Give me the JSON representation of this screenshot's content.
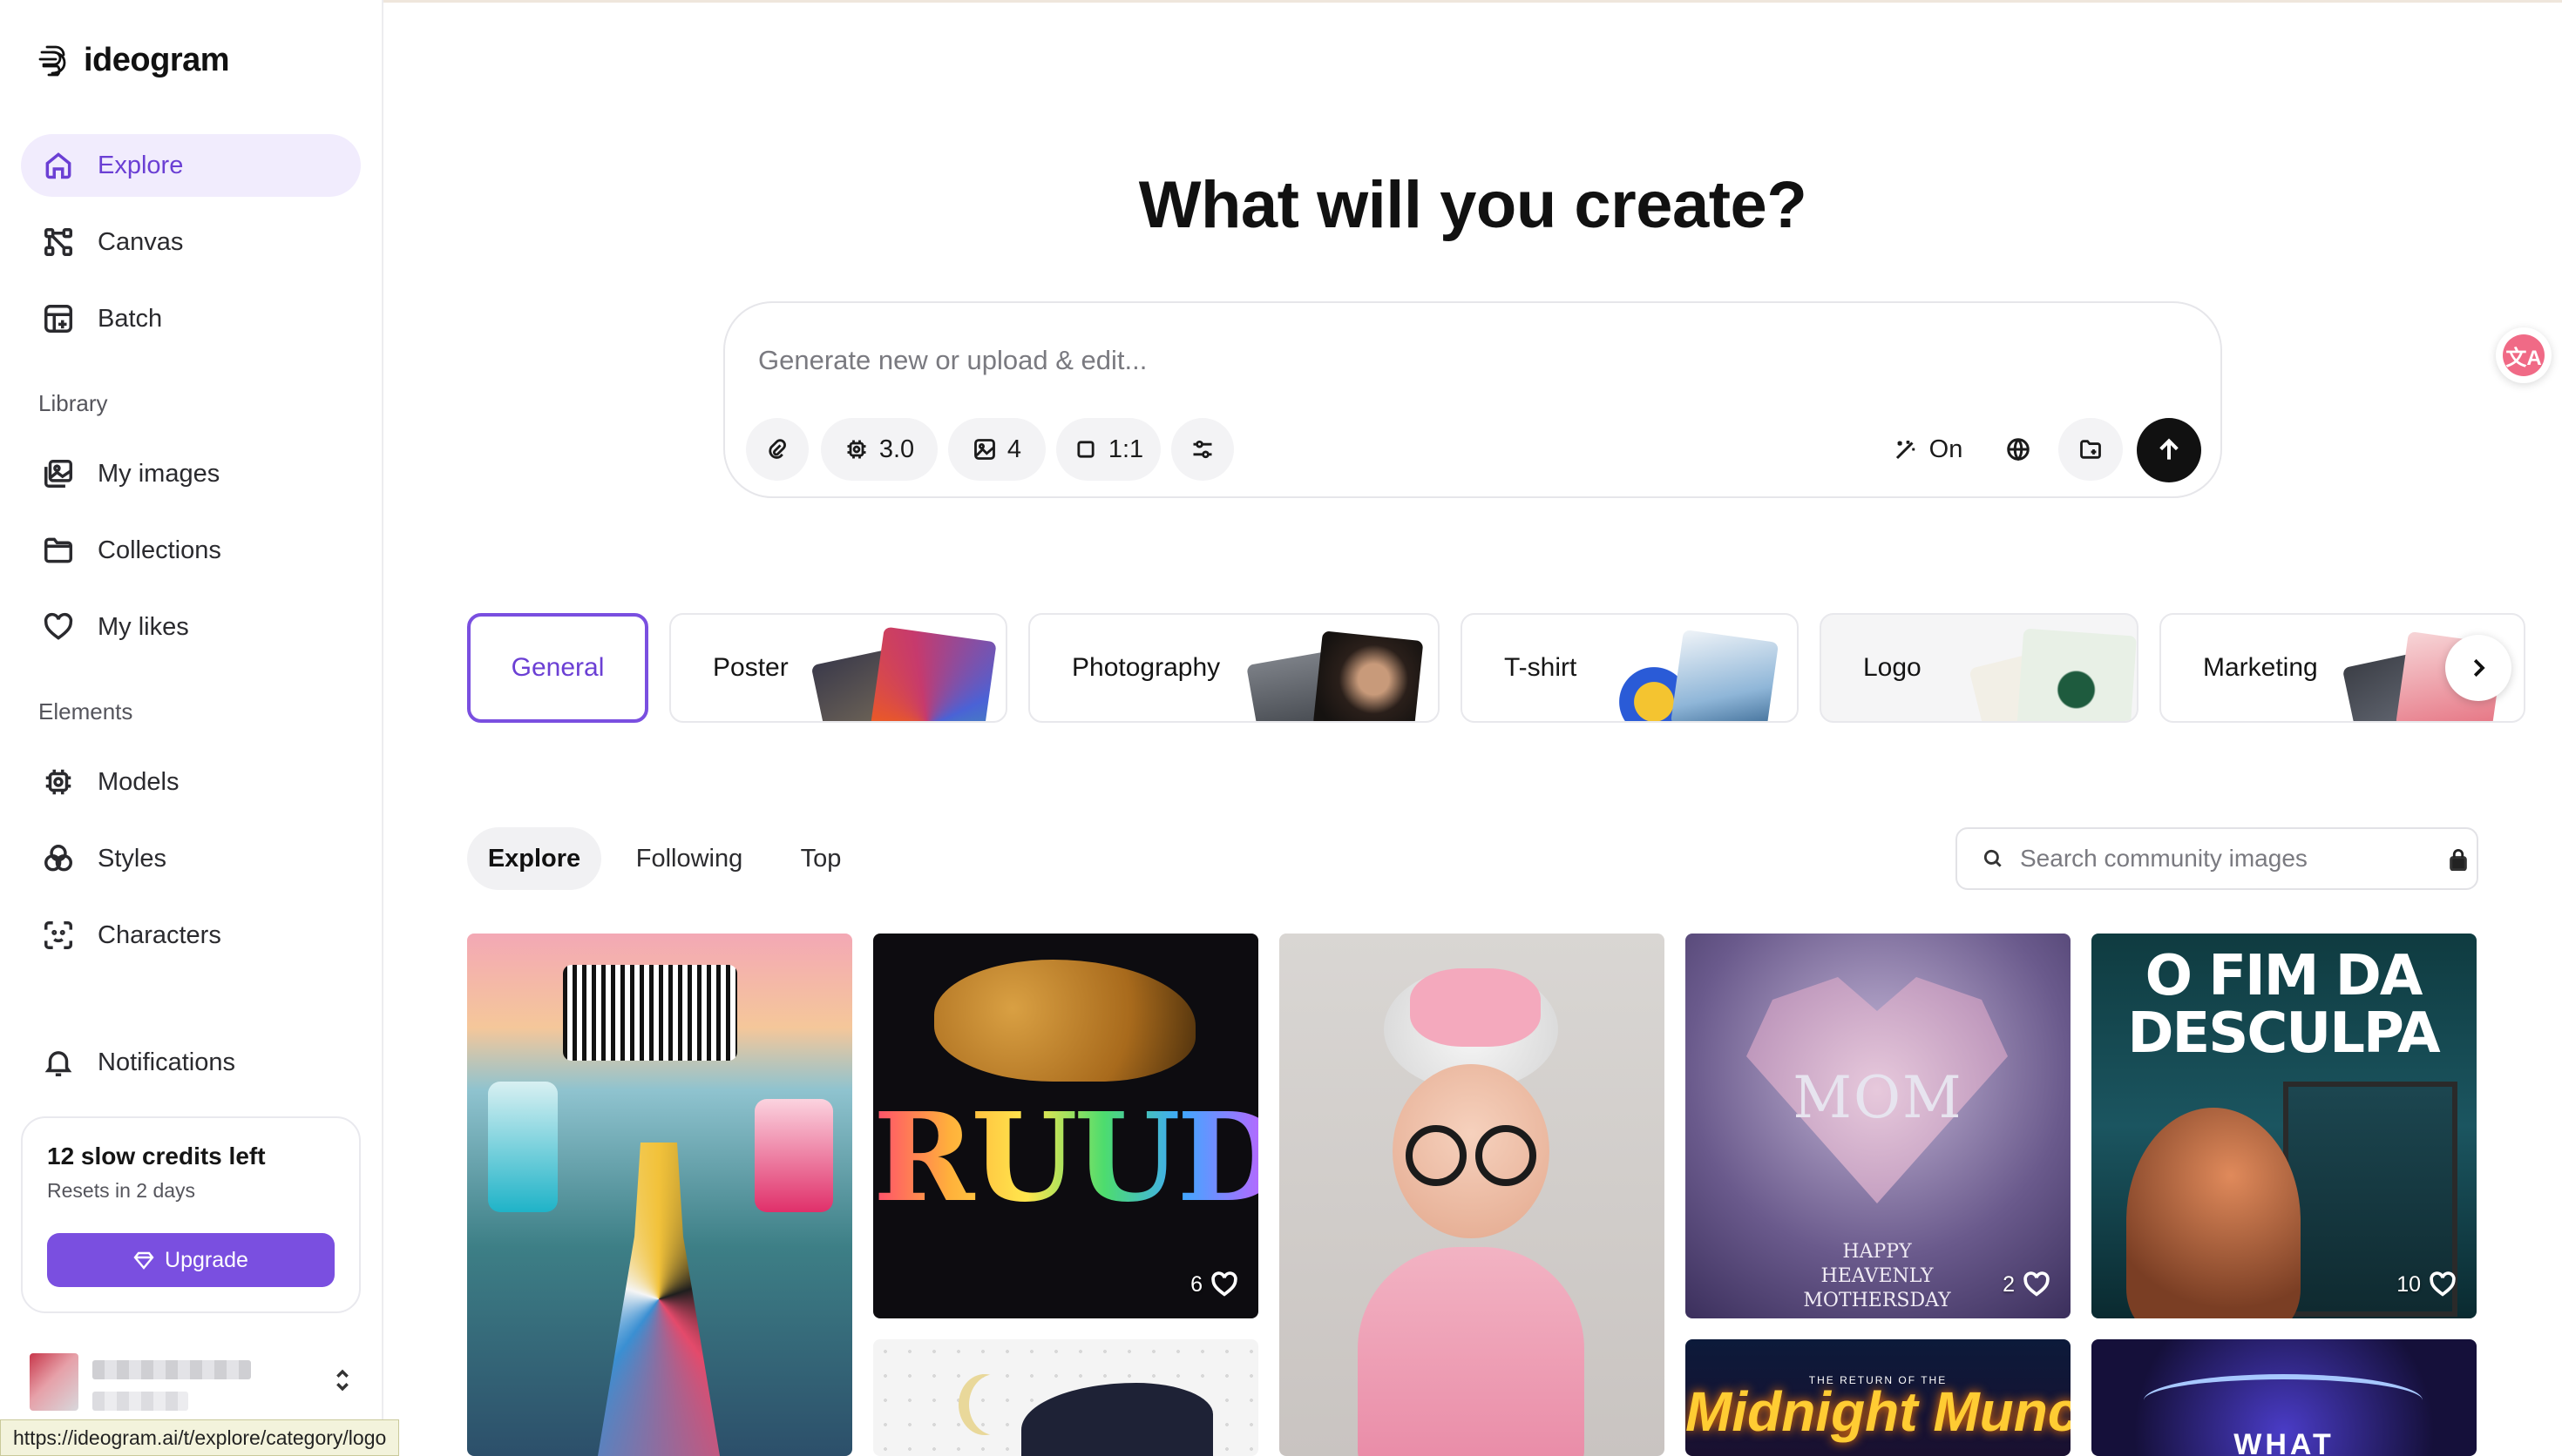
{
  "brand": {
    "name": "ideogram"
  },
  "sidebar": {
    "nav": [
      {
        "label": "Explore",
        "icon": "home-icon",
        "active": true
      },
      {
        "label": "Canvas",
        "icon": "canvas-icon"
      },
      {
        "label": "Batch",
        "icon": "batch-icon"
      }
    ],
    "library_label": "Library",
    "library": [
      {
        "label": "My images",
        "icon": "images-icon"
      },
      {
        "label": "Collections",
        "icon": "folder-icon"
      },
      {
        "label": "My likes",
        "icon": "heart-icon"
      }
    ],
    "elements_label": "Elements",
    "elements": [
      {
        "label": "Models",
        "icon": "chip-icon"
      },
      {
        "label": "Styles",
        "icon": "styles-icon"
      },
      {
        "label": "Characters",
        "icon": "character-icon"
      }
    ],
    "notifications": {
      "label": "Notifications",
      "icon": "bell-icon"
    },
    "credits": {
      "title": "12 slow credits left",
      "subtitle": "Resets in 2 days",
      "upgrade_label": "Upgrade"
    }
  },
  "status_url": "https://ideogram.ai/t/explore/category/logo",
  "main": {
    "headline": "What will you create?",
    "prompt": {
      "placeholder": "Generate new or upload & edit...",
      "model_version": "3.0",
      "image_count": "4",
      "aspect_ratio": "1:1",
      "magic_prompt": "On"
    },
    "categories": [
      {
        "label": "General",
        "active": true
      },
      {
        "label": "Poster"
      },
      {
        "label": "Photography"
      },
      {
        "label": "T-shirt"
      },
      {
        "label": "Logo"
      },
      {
        "label": "Marketing"
      }
    ],
    "feed_tabs": [
      {
        "label": "Explore",
        "active": true
      },
      {
        "label": "Following"
      },
      {
        "label": "Top"
      }
    ],
    "search": {
      "placeholder": "Search community images"
    },
    "cards": [
      {
        "title": "",
        "likes": ""
      },
      {
        "title": "RUUD",
        "likes": "6"
      },
      {
        "title": "",
        "likes": ""
      },
      {
        "title": "MOM",
        "subtitle": "HAPPY HEAVENLY MOTHERSDAY",
        "likes": "2"
      },
      {
        "title": "O FIM DA DESCULPA",
        "likes": "10"
      },
      {
        "title": "",
        "likes": ""
      },
      {
        "title": "Midnight Munchies:",
        "kicker": "THE RETURN OF THE",
        "likes": ""
      },
      {
        "title": "WHAT",
        "likes": ""
      }
    ]
  },
  "colors": {
    "accent": "#7a4fe0",
    "active_bg": "#f1ecfd",
    "send_button": "#111111"
  }
}
